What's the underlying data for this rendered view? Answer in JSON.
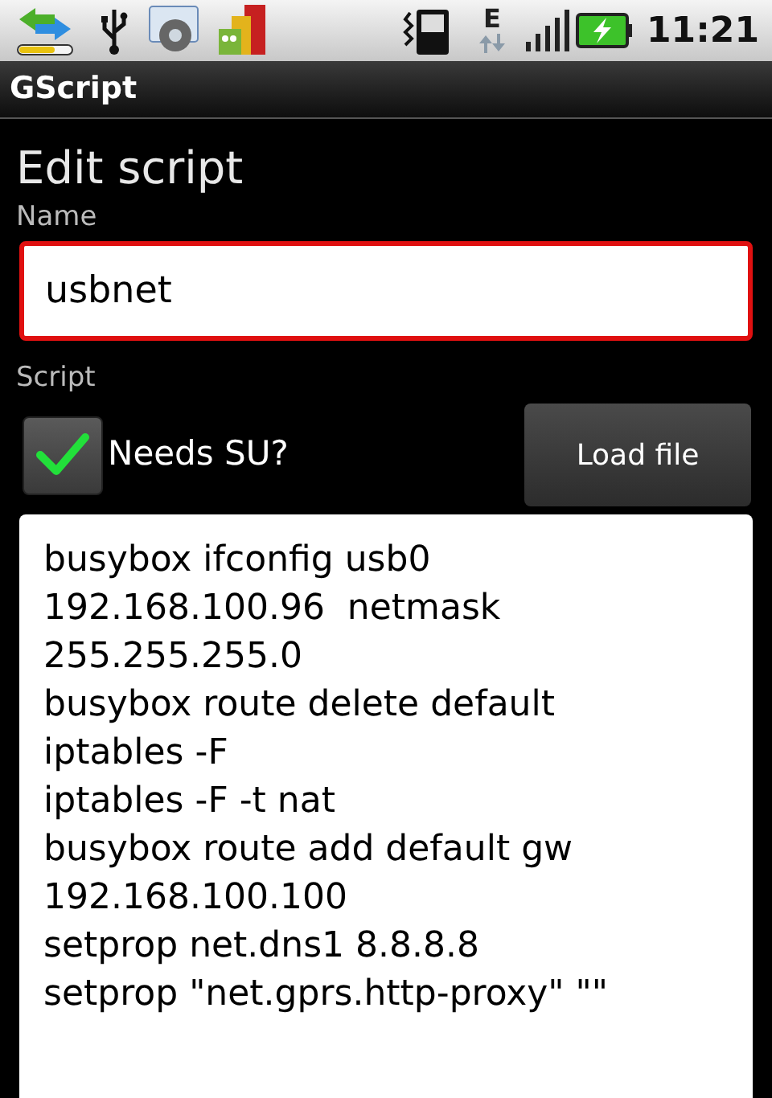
{
  "status_bar": {
    "network_type": "E",
    "time": "11:21"
  },
  "app_bar": {
    "title": "GScript"
  },
  "heading": "Edit script",
  "name_field": {
    "label": "Name",
    "value": "usbnet",
    "focused": true
  },
  "script_label": "Script",
  "needs_su": {
    "label": "Needs SU?",
    "checked": true
  },
  "load_button": "Load file",
  "script_lines": [
    "busybox ifconfig usb0",
    "192.168.100.96  netmask",
    "255.255.255.0",
    "busybox route delete default",
    "iptables -F",
    "iptables -F -t nat",
    "busybox route add default gw",
    "192.168.100.100",
    "setprop net.dns1 8.8.8.8",
    "setprop \"net.gprs.http-proxy\" \"\""
  ]
}
